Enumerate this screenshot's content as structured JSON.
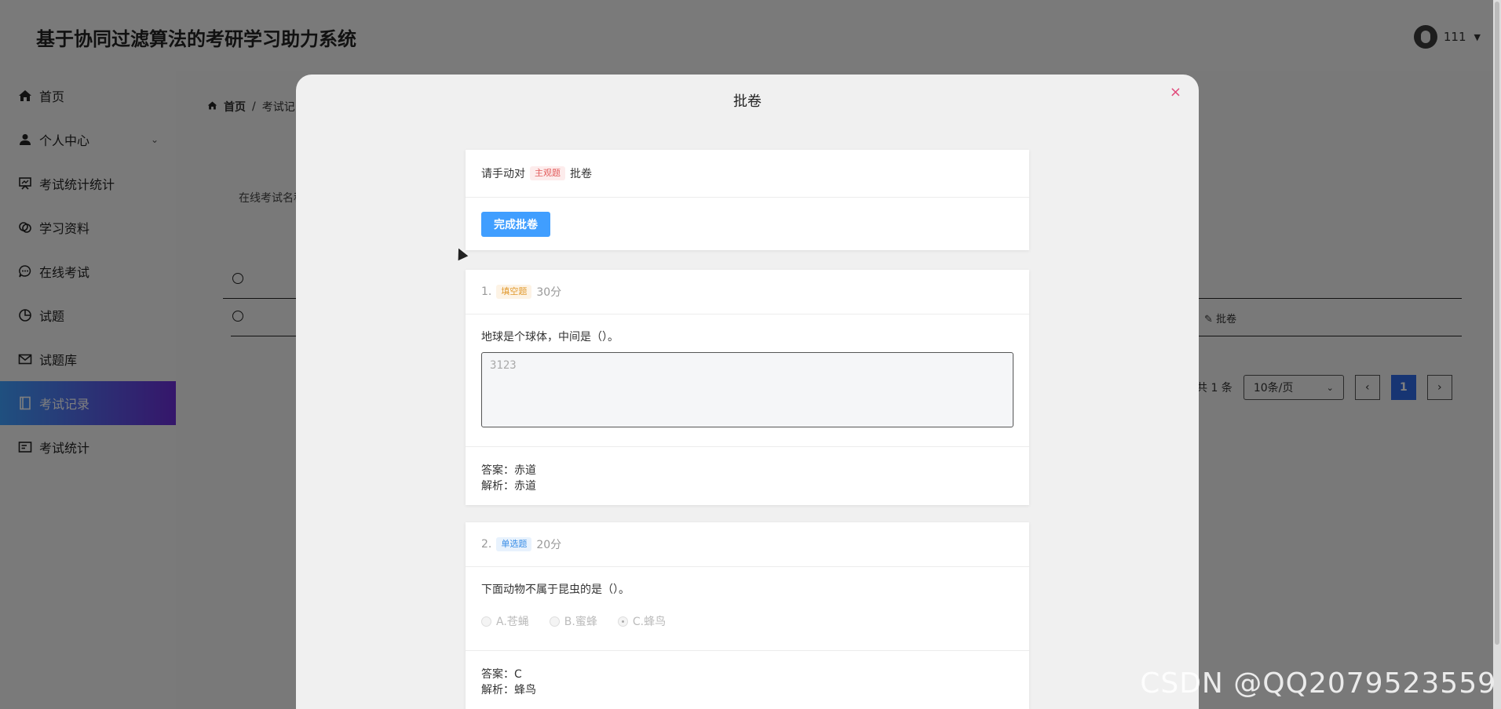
{
  "app": {
    "title": "基于协同过滤算法的考研学习助力系统",
    "user": "111"
  },
  "sidebar": {
    "items": [
      {
        "label": "首页",
        "icon": "home-icon"
      },
      {
        "label": "个人中心",
        "icon": "user-icon"
      },
      {
        "label": "考试统计统计",
        "icon": "easel-icon"
      },
      {
        "label": "学习资料",
        "icon": "link-icon"
      },
      {
        "label": "在线考试",
        "icon": "chat-icon"
      },
      {
        "label": "试题",
        "icon": "pie-chart-icon"
      },
      {
        "label": "试题库",
        "icon": "mail-icon"
      },
      {
        "label": "考试记录",
        "icon": "notebook-icon"
      },
      {
        "label": "考试统计",
        "icon": "card-icon"
      }
    ]
  },
  "content": {
    "breadcrumb": {
      "home": "首页",
      "sep": "/",
      "current": "考试记"
    },
    "filter_label": "在线考试名称",
    "row_action": "批卷",
    "pagination": {
      "total": "共 1 条",
      "page_size": "10条/页",
      "current": "1",
      "prev": "‹",
      "next": "›"
    }
  },
  "modal": {
    "title": "批卷",
    "close": "×",
    "instruction": {
      "prefix": "请手动对",
      "tag": "主观题",
      "suffix": "批卷"
    },
    "finish_button": "完成批卷",
    "questions": [
      {
        "index": "1.",
        "type": "填空题",
        "score": "30分",
        "stem": "地球是个球体，中间是（）。",
        "user_answer": "3123",
        "answer": "答案：赤道",
        "analysis": "解析：赤道"
      },
      {
        "index": "2.",
        "type": "单选题",
        "score": "20分",
        "stem": "下面动物不属于昆虫的是（）。",
        "options": [
          "A.苍蝇",
          "B.蜜蜂",
          "C.蜂鸟"
        ],
        "answer": "答案：C",
        "analysis": "解析：蜂鸟"
      }
    ]
  },
  "watermark": "CSDN @QQ2079523559"
}
